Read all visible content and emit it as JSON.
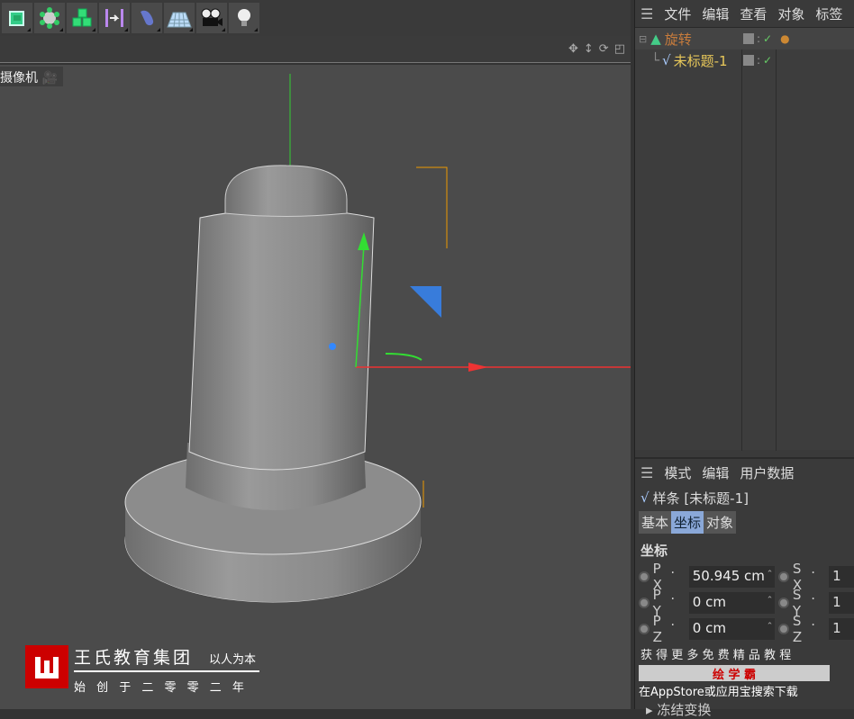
{
  "toolbar": {
    "icons": [
      "cube-icon",
      "polygon-pen-icon",
      "cloner-icon",
      "symmetry-icon",
      "deformer-icon",
      "floor-icon",
      "camera-icon",
      "light-icon"
    ]
  },
  "viewport": {
    "camera_label": "摄像机"
  },
  "object_manager": {
    "menu": [
      "文件",
      "编辑",
      "查看",
      "对象",
      "标签"
    ],
    "objects": [
      {
        "name": "旋转",
        "color": "#c87c3c"
      },
      {
        "name": "未标题-1",
        "color": "#e8c85a"
      }
    ]
  },
  "attributes": {
    "menu": [
      "模式",
      "编辑",
      "用户数据"
    ],
    "title": "样条 [未标题-1]",
    "tabs": [
      "基本",
      "坐标",
      "对象"
    ],
    "active_tab": "坐标",
    "section": "坐标",
    "rows": [
      {
        "p": "P . X",
        "pv": "50.945 cm",
        "s": "S . X",
        "sv": "1"
      },
      {
        "p": "P . Y",
        "pv": "0 cm",
        "s": "S . Y",
        "sv": "1"
      },
      {
        "p": "P . Z",
        "pv": "0 cm",
        "s": "S . Z",
        "sv": "1"
      }
    ],
    "freeze": "冻结变换"
  },
  "watermark": {
    "company": "王氏教育集团",
    "slogan": "以人为本",
    "founded": "始 创 于 二 零 零 二 年",
    "promo_line1": "获 得 更 多 免 费 精 品 教 程",
    "promo_brand": "绘 学 霸",
    "promo_line2": "在AppStore或应用宝搜索下载"
  }
}
